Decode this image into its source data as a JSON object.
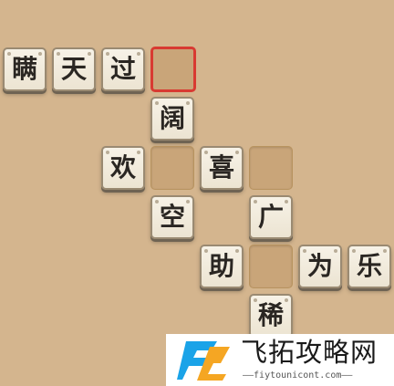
{
  "grid": {
    "r0c0": "瞒",
    "r0c1": "天",
    "r0c2": "过",
    "r1c3": "阔",
    "r2c2": "欢",
    "r2c4": "喜",
    "r3c3": "空",
    "r3c5": "广",
    "r4c4": "助",
    "r4c6": "为",
    "r4c7": "乐",
    "r5c5": "稀"
  },
  "selected_cell": "r0c3",
  "empty_cells": [
    "r0c3",
    "r2c3",
    "r2c5",
    "r4c5"
  ],
  "colors": {
    "background": "#d4b58e",
    "tile_face": "#f2ece0",
    "empty_slot": "#c9a579",
    "selection_border": "#d83a32"
  },
  "watermark": {
    "title": "飞拓攻略网",
    "url": "——fiytounicont.com——",
    "logo_colors": [
      "#1aa3e8",
      "#f5a623"
    ]
  }
}
